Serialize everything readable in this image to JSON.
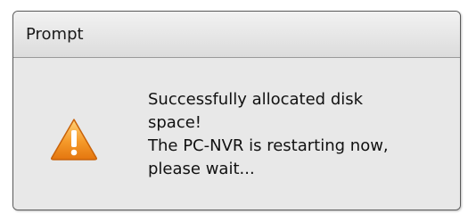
{
  "dialog": {
    "title": "Prompt",
    "message_lines": [
      "Successfully allocated disk",
      "space!",
      "The PC-NVR is restarting now,",
      "please wait..."
    ],
    "icon": "warning-icon"
  },
  "colors": {
    "warning_orange": "#f08a1c",
    "warning_light": "#ffd27a"
  }
}
